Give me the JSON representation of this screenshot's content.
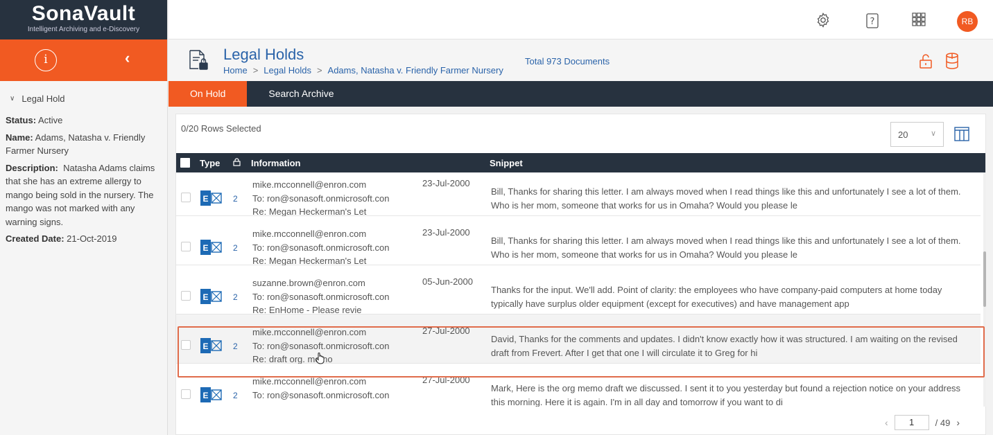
{
  "brand": {
    "name": "SonaVault",
    "tagline": "Intelligent Archiving and e-Discovery"
  },
  "user": {
    "initials": "RB"
  },
  "hold": {
    "section_label": "Legal Hold",
    "status_label": "Status:",
    "status": "Active",
    "name_label": "Name:",
    "name": "Adams, Natasha v. Friendly Farmer Nursery",
    "description_label": "Description:",
    "description": "Natasha Adams claims that she has an extreme allergy to mango being sold in the nursery. The mango was not marked with any warning signs.",
    "created_label": "Created Date:",
    "created": "21-Oct-2019"
  },
  "page": {
    "title": "Legal Holds",
    "breadcrumb": [
      "Home",
      "Legal Holds",
      "Adams, Natasha v. Friendly Farmer Nursery"
    ],
    "breadcrumb_sep": ">",
    "total": "Total 973 Documents"
  },
  "tabs": [
    "On Hold",
    "Search Archive"
  ],
  "table": {
    "rows_selected": "0/20 Rows Selected",
    "page_size": "20",
    "headers": {
      "type": "Type",
      "information": "Information",
      "snippet": "Snippet"
    },
    "rows": [
      {
        "count": "2",
        "from": "mike.mcconnell@enron.com",
        "to": "To: ron@sonasoft.onmicrosoft.con",
        "re": "Re: Megan Heckerman's Let",
        "date": "23-Jul-2000",
        "snippet1": "Bill, Thanks for sharing this letter. I am always moved when I read things like this and unfortunately I see a lot of them.",
        "snippet2": "Who is her mom, someone that works for us in Omaha? Would you please le"
      },
      {
        "count": "2",
        "from": "mike.mcconnell@enron.com",
        "to": "To: ron@sonasoft.onmicrosoft.con",
        "re": "Re: Megan Heckerman's Let",
        "date": "23-Jul-2000",
        "snippet1": "Bill, Thanks for sharing this letter. I am always moved when I read things like this and unfortunately I see a lot of them.",
        "snippet2": "Who is her mom, someone that works for us in Omaha? Would you please le"
      },
      {
        "count": "2",
        "from": "suzanne.brown@enron.com",
        "to": "To: ron@sonasoft.onmicrosoft.con",
        "re": "Re: EnHome - Please revie",
        "date": "05-Jun-2000",
        "snippet1": "Thanks for the input. We'll add. Point of clarity: the employees who have company-paid computers at home today",
        "snippet2": "typically have surplus older equipment (except for executives) and have management app"
      },
      {
        "count": "2",
        "from": "mike.mcconnell@enron.com",
        "to": "To: ron@sonasoft.onmicrosoft.con",
        "re": "Re: draft org. memo",
        "date": "27-Jul-2000",
        "snippet1": "David, Thanks for the comments and updates. I didn't know exactly how it was structured. I am waiting on the revised",
        "snippet2": "draft from Frevert. After I get that one I will circulate it to Greg for hi"
      },
      {
        "count": "2",
        "from": "mike.mcconnell@enron.com",
        "to": "To: ron@sonasoft.onmicrosoft.con",
        "re": "",
        "date": "27-Jul-2000",
        "snippet1": "Mark, Here is the org memo draft we discussed. I sent it to you yesterday but found a rejection notice on your address",
        "snippet2": "this morning. Here it is again. I'm in all day and tomorrow if you want to di"
      }
    ]
  },
  "pager": {
    "current": "1",
    "total": "/ 49"
  },
  "colors": {
    "brand_orange": "#f15a22",
    "navy": "#27323f",
    "link_blue": "#2a63a9"
  }
}
